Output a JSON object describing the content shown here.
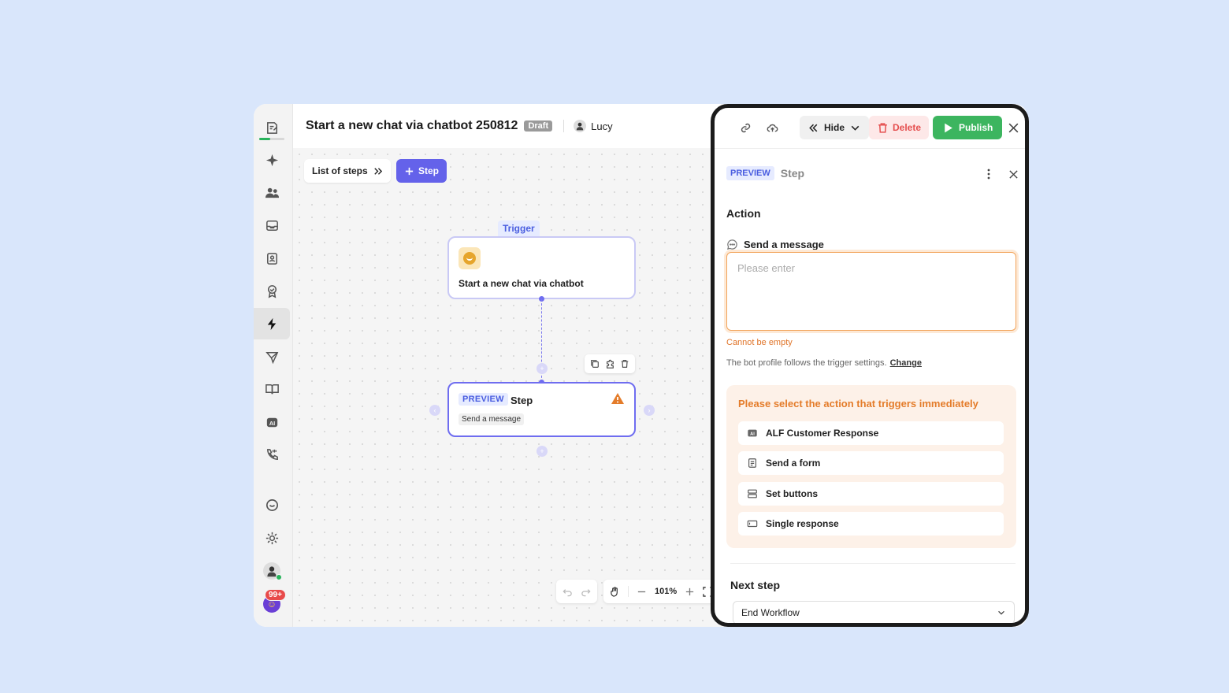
{
  "header": {
    "title": "Start a new chat via chatbot 250812",
    "status": "Draft",
    "user": "Lucy"
  },
  "sidebar": {
    "icons": [
      "workflow-note-icon",
      "sparkle-icon",
      "users-icon",
      "inbox-icon",
      "contact-card-icon",
      "badge-check-icon",
      "lightning-icon",
      "send-icon",
      "book-icon",
      "ai-icon",
      "phone-icon",
      "chat-bubble-icon",
      "gear-icon"
    ],
    "active": "lightning-icon",
    "setup_progress": 0.45,
    "notification_count": "99+"
  },
  "canvas": {
    "steps_list_label": "List of steps",
    "add_step_label": "Step",
    "trigger_tag": "Trigger",
    "trigger_title": "Start a new chat via chatbot",
    "step_tag": "PREVIEW",
    "step_name": "Step",
    "step_chip": "Send a message",
    "zoom": "101%"
  },
  "panel": {
    "toolbar": {
      "hide_label": "Hide",
      "delete_label": "Delete",
      "publish_label": "Publish"
    },
    "step_tag": "PREVIEW",
    "step_name": "Step",
    "action_heading": "Action",
    "message_label": "Send a message",
    "message_value": "",
    "message_placeholder": "Please enter",
    "error_text": "Cannot be empty",
    "note_text": "The bot profile follows the trigger settings.",
    "note_link": "Change",
    "options_title": "Please select the action that triggers immediately",
    "options": [
      {
        "label": "ALF Customer Response",
        "icon": "ai-icon"
      },
      {
        "label": "Send a form",
        "icon": "form-icon"
      },
      {
        "label": "Set buttons",
        "icon": "buttons-icon"
      },
      {
        "label": "Single response",
        "icon": "single-response-icon"
      }
    ],
    "next_step_heading": "Next step",
    "next_step_value": "End Workflow"
  },
  "colors": {
    "accent": "#6462ea",
    "publish": "#3cb55f",
    "delete": "#e55050",
    "warning": "#e47c2a",
    "background": "#d9e6fb"
  }
}
